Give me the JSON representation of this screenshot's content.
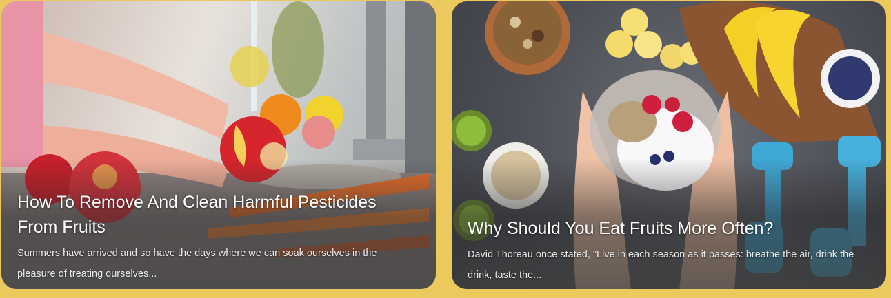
{
  "cards": [
    {
      "title": "How To Remove And Clean Harmful Pesticides From Fruits",
      "excerpt": "Summers have arrived and so have the days where we can soak ourselves in the pleasure of treating ourselves..."
    },
    {
      "title": "Why Should You Eat Fruits More Often?",
      "excerpt": "David Thoreau once stated, \"Live in each season as it passes: breathe the air, drink the drink, taste the..."
    }
  ],
  "colors": {
    "page_background": "#ecc95c",
    "dumbbell": "#3fa9d6"
  }
}
